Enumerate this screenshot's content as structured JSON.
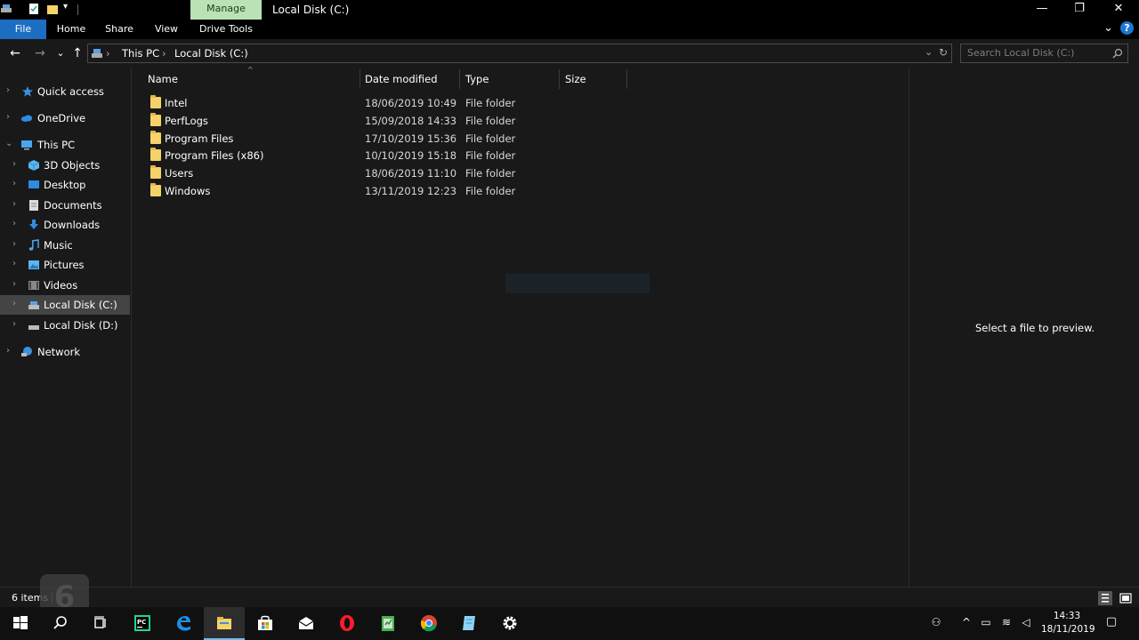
{
  "window": {
    "title": "Local Disk (C:)",
    "context_tab": "Manage",
    "minimize_glyph": "—",
    "restore_glyph": "❐",
    "close_glyph": "✕"
  },
  "ribbon": {
    "tabs": [
      "File",
      "Home",
      "Share",
      "View",
      "Drive Tools"
    ],
    "expand_glyph": "⌄",
    "help_glyph": "?"
  },
  "address": {
    "crumbs": [
      "This PC",
      "Local Disk (C:)"
    ],
    "separator": "›",
    "search_placeholder": "Search Local Disk (C:)"
  },
  "nav": {
    "back": "←",
    "forward": "→",
    "recent": "⌄",
    "up": "↑",
    "items": [
      {
        "label": "Quick access",
        "icon": "star-icon"
      },
      {
        "label": "OneDrive",
        "icon": "cloud-icon"
      },
      {
        "label": "This PC",
        "icon": "computer-icon"
      },
      {
        "label": "3D Objects",
        "icon": "cube-icon"
      },
      {
        "label": "Desktop",
        "icon": "desktop-icon"
      },
      {
        "label": "Documents",
        "icon": "document-icon"
      },
      {
        "label": "Downloads",
        "icon": "download-icon"
      },
      {
        "label": "Music",
        "icon": "music-icon"
      },
      {
        "label": "Pictures",
        "icon": "picture-icon"
      },
      {
        "label": "Videos",
        "icon": "video-icon"
      },
      {
        "label": "Local Disk (C:)",
        "icon": "drive-icon"
      },
      {
        "label": "Local Disk (D:)",
        "icon": "drive-icon"
      },
      {
        "label": "Network",
        "icon": "network-icon"
      }
    ],
    "selected": "Local Disk (C:)"
  },
  "columns": [
    "Name",
    "Date modified",
    "Type",
    "Size"
  ],
  "files": [
    {
      "name": "Intel",
      "date": "18/06/2019 10:49",
      "type": "File folder",
      "size": ""
    },
    {
      "name": "PerfLogs",
      "date": "15/09/2018 14:33",
      "type": "File folder",
      "size": ""
    },
    {
      "name": "Program Files",
      "date": "17/10/2019 15:36",
      "type": "File folder",
      "size": ""
    },
    {
      "name": "Program Files (x86)",
      "date": "10/10/2019 15:18",
      "type": "File folder",
      "size": ""
    },
    {
      "name": "Users",
      "date": "18/06/2019 11:10",
      "type": "File folder",
      "size": ""
    },
    {
      "name": "Windows",
      "date": "13/11/2019 12:23",
      "type": "File folder",
      "size": ""
    }
  ],
  "preview": {
    "text": "Select a file to preview."
  },
  "status": {
    "count": "6 items",
    "watermark": "6"
  },
  "taskbar": {
    "apps": [
      "start-icon",
      "search-icon",
      "task-view-icon",
      "pycharm-icon",
      "edge-icon",
      "file-explorer-icon",
      "store-icon",
      "mail-icon",
      "opera-icon",
      "notepad-icon",
      "chrome-icon",
      "notes-icon",
      "settings-icon"
    ],
    "active": "file-explorer-icon",
    "time": "14:33",
    "date": "18/11/2019"
  },
  "colors": {
    "accent": "#1c6ec3",
    "manage_tab": "#b9e3b5",
    "background": "#191919",
    "folder": "#f5d36a"
  }
}
